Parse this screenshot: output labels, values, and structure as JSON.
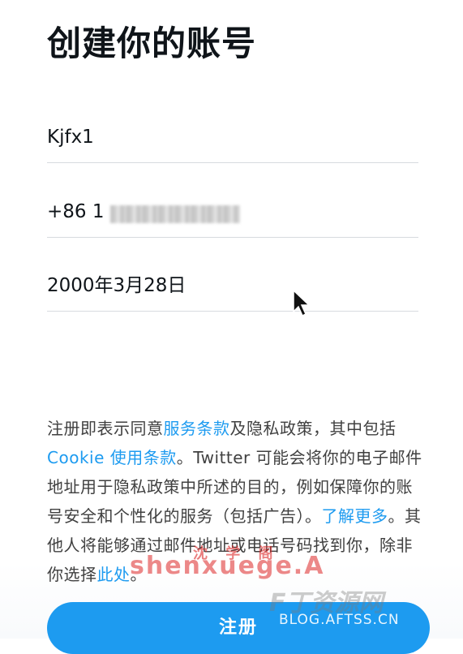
{
  "header": {
    "title": "创建你的账号"
  },
  "form": {
    "name": "Kjfx1",
    "phone_prefix": "+86 1",
    "birthdate": "2000年3月28日"
  },
  "terms": {
    "part1": "注册即表示同意",
    "tos": "服务条款",
    "part2": "及隐私政策，其中包括",
    "cookie": "Cookie 使用条款",
    "part3": "。Twitter 可能会将你的电子邮件地址用于隐私政策中所述的目的，例如保障你的账号安全和个性化的服务（包括广告）。",
    "learn_more": "了解更多",
    "part4": "。其他人将能够通过邮件地址或电话号码找到你，除非你选择",
    "here": "此处",
    "part5": "。"
  },
  "actions": {
    "signup": "注册"
  },
  "watermarks": {
    "left_top": "沈 学 阁",
    "left_main": "shenxuege.A",
    "right_main": "F丁资源网",
    "right_sub": "BLOG.AFTSS.CN"
  },
  "colors": {
    "accent": "#1d9bf0",
    "text": "#0f1419"
  }
}
